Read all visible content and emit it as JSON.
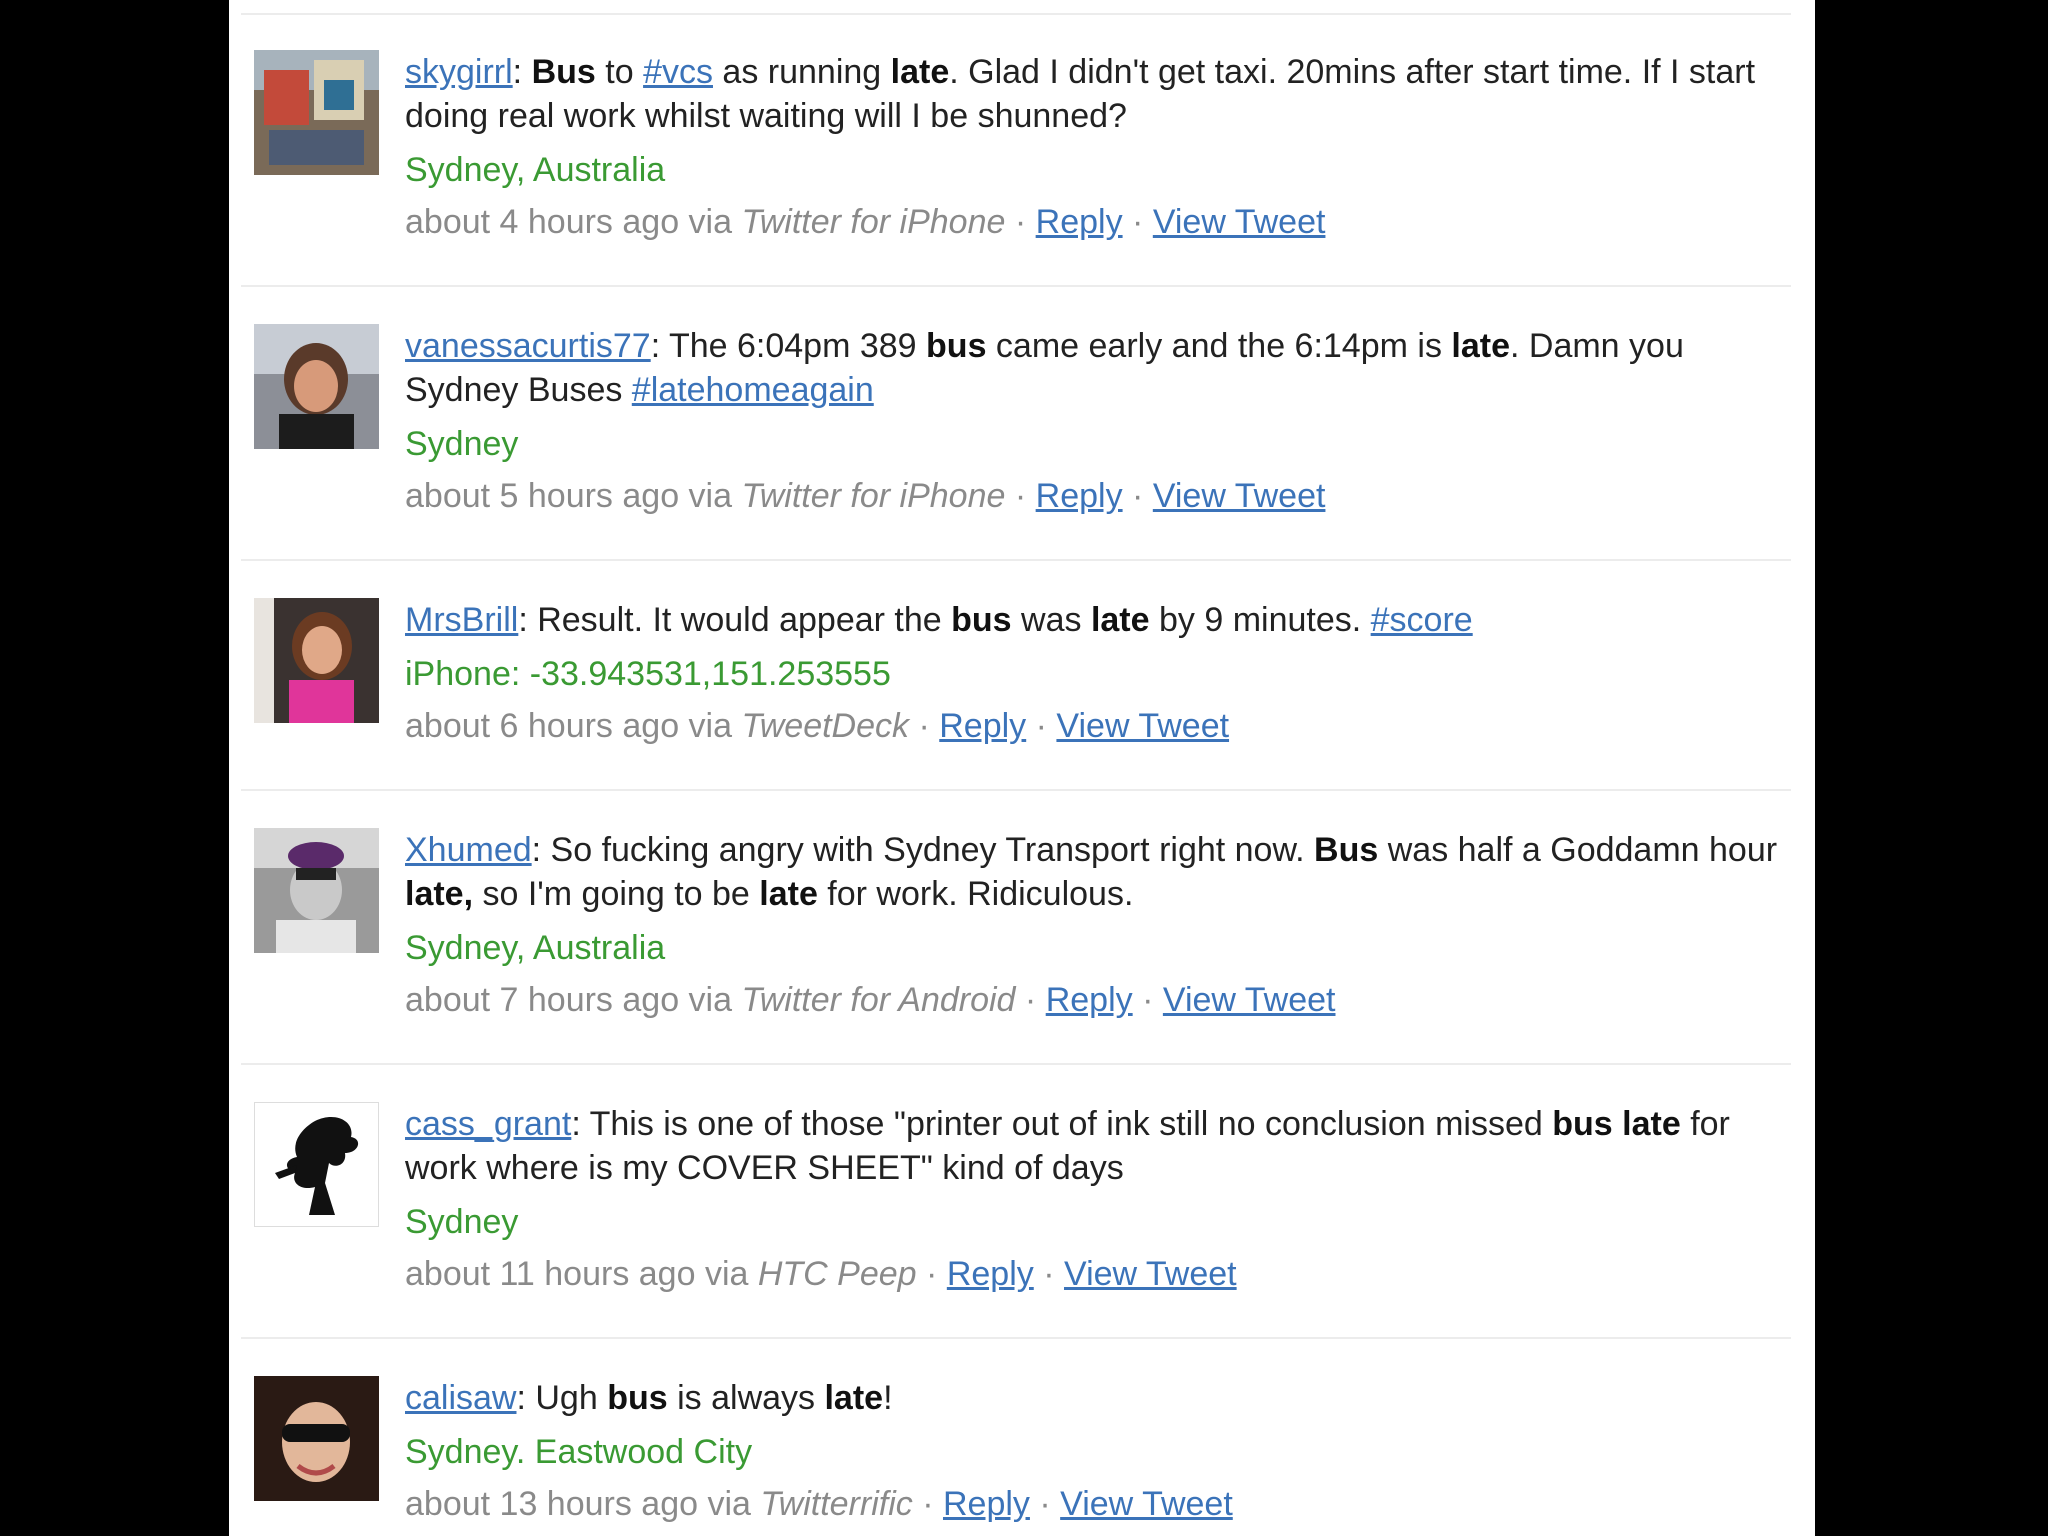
{
  "tweets": [
    {
      "user": "skygirrl",
      "segments": [
        {
          "t": ": "
        },
        {
          "t": "Bus",
          "b": true
        },
        {
          "t": " to "
        },
        {
          "t": "#vcs",
          "link": true
        },
        {
          "t": " as running "
        },
        {
          "t": "late",
          "b": true
        },
        {
          "t": ". Glad I didn't get taxi. 20mins after start time. If I start doing real work whilst waiting will I be shunned?"
        }
      ],
      "location": "Sydney, Australia",
      "time": "about 4 hours ago via",
      "source": "Twitter for iPhone",
      "reply": "Reply",
      "view": "View Tweet"
    },
    {
      "user": "vanessacurtis77",
      "segments": [
        {
          "t": ": The 6:04pm 389 "
        },
        {
          "t": "bus",
          "b": true
        },
        {
          "t": " came early and the 6:14pm is "
        },
        {
          "t": "late",
          "b": true
        },
        {
          "t": ". Damn you Sydney Buses "
        },
        {
          "t": "#latehomeagain",
          "link": true
        }
      ],
      "location": "Sydney",
      "time": "about 5 hours ago via",
      "source": "Twitter for iPhone",
      "reply": "Reply",
      "view": "View Tweet"
    },
    {
      "user": "MrsBrill",
      "segments": [
        {
          "t": ": Result. It would appear the "
        },
        {
          "t": "bus",
          "b": true
        },
        {
          "t": " was "
        },
        {
          "t": "late",
          "b": true
        },
        {
          "t": " by 9 minutes. "
        },
        {
          "t": "#score",
          "link": true
        }
      ],
      "location": "iPhone: -33.943531,151.253555",
      "time": "about 6 hours ago via",
      "source": "TweetDeck",
      "reply": "Reply",
      "view": "View Tweet"
    },
    {
      "user": "Xhumed",
      "segments": [
        {
          "t": ": So fucking angry with Sydney Transport right now. "
        },
        {
          "t": "Bus",
          "b": true
        },
        {
          "t": " was half a Goddamn hour "
        },
        {
          "t": "late,",
          "b": true
        },
        {
          "t": " so I'm going to be "
        },
        {
          "t": "late",
          "b": true
        },
        {
          "t": " for work. Ridiculous."
        }
      ],
      "location": "Sydney, Australia",
      "time": "about 7 hours ago via",
      "source": "Twitter for Android",
      "reply": "Reply",
      "view": "View Tweet"
    },
    {
      "user": "cass_grant",
      "segments": [
        {
          "t": ": This is one of those \"printer out of ink still no conclusion missed "
        },
        {
          "t": "bus",
          "b": true
        },
        {
          "t": " "
        },
        {
          "t": "late",
          "b": true
        },
        {
          "t": " for work where is my COVER SHEET\" kind of days"
        }
      ],
      "location": "Sydney",
      "time": "about 11 hours ago via",
      "source": "HTC Peep",
      "reply": "Reply",
      "view": "View Tweet"
    },
    {
      "user": "calisaw",
      "segments": [
        {
          "t": ": Ugh "
        },
        {
          "t": "bus",
          "b": true
        },
        {
          "t": " is always "
        },
        {
          "t": "late",
          "b": true
        },
        {
          "t": "!"
        }
      ],
      "location": "Sydney. Eastwood City",
      "time": "about 13 hours ago via",
      "source": "Twitterrific",
      "reply": "Reply",
      "view": "View Tweet"
    }
  ],
  "colors": {
    "link": "#3b73b9",
    "location": "#3a9a33",
    "meta": "#8a8a8a",
    "text": "#222222"
  }
}
